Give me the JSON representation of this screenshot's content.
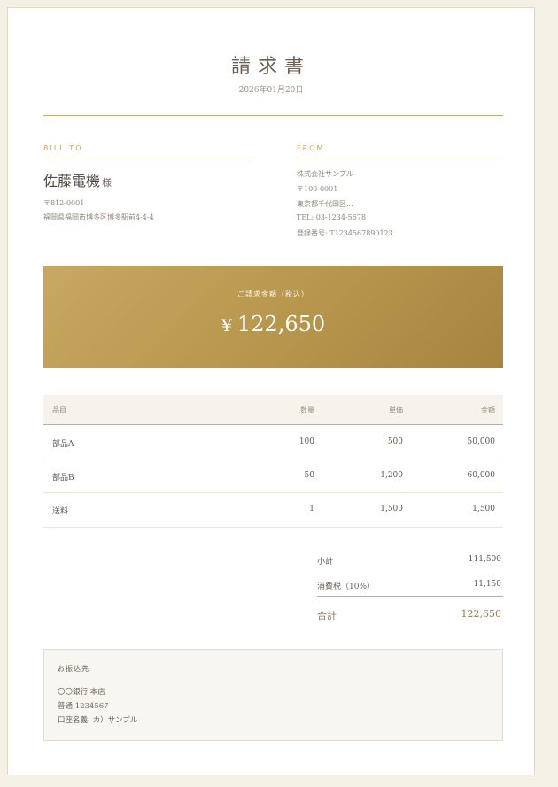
{
  "title": "請求書",
  "date": "2026年01月20日",
  "bill_to": {
    "heading": "BILL TO",
    "name": "佐藤電機",
    "honorific": "様",
    "postal": "〒812-0001",
    "address": "福岡県福岡市博多区博多駅前4-4-4"
  },
  "from": {
    "heading": "FROM",
    "company": "株式会社サンプル",
    "postal": "〒100-0001",
    "address": "東京都千代田区...",
    "tel": "TEL: 03-1234-5678",
    "registration": "登録番号: T1234567890123"
  },
  "amount": {
    "label": "ご請求金額（税込）",
    "currency": "¥",
    "value": "122,650"
  },
  "table": {
    "headers": {
      "item": "品目",
      "qty": "数量",
      "unit_price": "単価",
      "amount": "金額"
    },
    "rows": [
      {
        "item": "部品A",
        "qty": "100",
        "unit_price": "500",
        "amount": "50,000"
      },
      {
        "item": "部品B",
        "qty": "50",
        "unit_price": "1,200",
        "amount": "60,000"
      },
      {
        "item": "送料",
        "qty": "1",
        "unit_price": "1,500",
        "amount": "1,500"
      }
    ]
  },
  "summary": {
    "subtotal_label": "小計",
    "subtotal": "111,500",
    "tax_label": "消費税（10%）",
    "tax": "11,150",
    "total_label": "合計",
    "total": "122,650"
  },
  "bank": {
    "title": "お振込先",
    "bank_name": "〇〇銀行 本店",
    "account": "普通 1234567",
    "holder": "口座名義: カ）サンプル"
  },
  "colors": {
    "gold": "#c9ad78",
    "amount_bg": "#b8974e",
    "page_bg": "#f5f0e6"
  }
}
